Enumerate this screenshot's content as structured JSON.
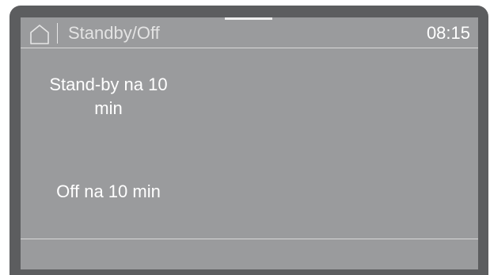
{
  "header": {
    "home_icon": "home-icon",
    "title": "Standby/Off",
    "time": "08:15"
  },
  "options": [
    {
      "label": "Stand-by na 10\nmin"
    },
    {
      "label": "Off na 10 min"
    }
  ],
  "colors": {
    "bezel": "#5c5d5f",
    "screen": "#9a9b9d",
    "text": "#ffffff"
  }
}
